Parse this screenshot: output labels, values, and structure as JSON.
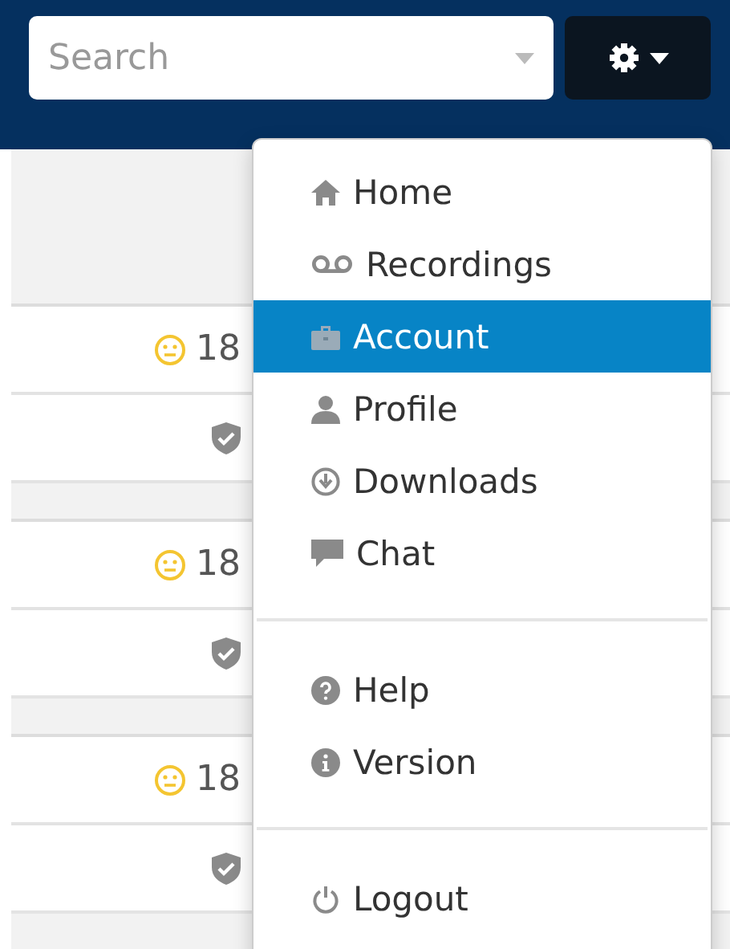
{
  "search": {
    "placeholder": "Search"
  },
  "rows": [
    {
      "kind": "score",
      "value": "18"
    },
    {
      "kind": "verified"
    },
    {
      "kind": "gap"
    },
    {
      "kind": "score",
      "value": "18"
    },
    {
      "kind": "verified"
    },
    {
      "kind": "gap"
    },
    {
      "kind": "score",
      "value": "18"
    },
    {
      "kind": "verified"
    },
    {
      "kind": "gap"
    }
  ],
  "menu": {
    "groups": [
      [
        {
          "label": "Home",
          "selected": false
        },
        {
          "label": "Recordings",
          "selected": false
        },
        {
          "label": "Account",
          "selected": true
        },
        {
          "label": "Profile",
          "selected": false
        },
        {
          "label": "Downloads",
          "selected": false
        },
        {
          "label": "Chat",
          "selected": false
        }
      ],
      [
        {
          "label": "Help",
          "selected": false
        },
        {
          "label": "Version",
          "selected": false
        }
      ],
      [
        {
          "label": "Logout",
          "selected": false
        }
      ]
    ]
  }
}
